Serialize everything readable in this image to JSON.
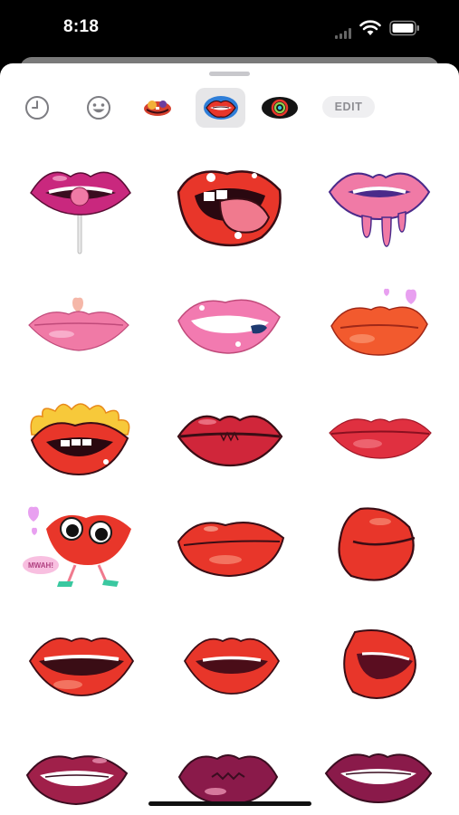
{
  "status_bar": {
    "time": "8:18"
  },
  "tabs": [
    {
      "name": "recents",
      "icon": "clock-icon"
    },
    {
      "name": "emoji",
      "icon": "smiley-icon"
    },
    {
      "name": "sticker-pack-1",
      "icon": "sticker-pack-icon"
    },
    {
      "name": "sticker-pack-lips",
      "icon": "lips-sticker-icon",
      "selected": true
    },
    {
      "name": "sticker-pack-3",
      "icon": "ring-sticker-icon"
    }
  ],
  "edit_label": "EDIT",
  "sticker_grid": {
    "columns": 3,
    "rows": [
      [
        "lollipop-lips",
        "tongue-lips",
        "dripping-lips"
      ],
      [
        "heart-lips",
        "biting-lips",
        "hearts-kiss-lips"
      ],
      [
        "flaming-lips",
        "sealed-lips",
        "red-lips"
      ],
      [
        "mwah-character-lips",
        "pouting-lips",
        "side-kiss-lips"
      ],
      [
        "open-smile-lips",
        "parted-lips",
        "side-open-lips"
      ],
      [
        "dark-biting-lips",
        "dark-pucker-lips",
        "dark-parted-lips"
      ]
    ],
    "mwah_text": "MWAH!"
  },
  "colors": {
    "sheet_background": "#ffffff",
    "selected_tab_background": "#e6e6e8",
    "lips_red": "#e8362a",
    "lips_pink": "#f07aa6",
    "lips_magenta": "#c2307a",
    "lips_dark": "#8a1a3a",
    "outline": "#3a0d15"
  }
}
